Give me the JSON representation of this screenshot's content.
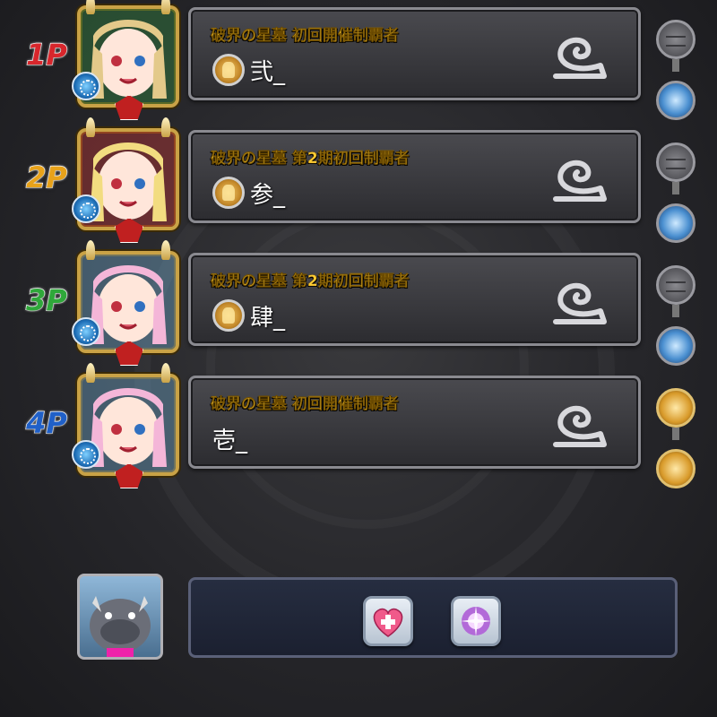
{
  "players": [
    {
      "label": "1P",
      "label_color": "#d8262c",
      "title": "破界の星墓 初回開催制覇者",
      "name": "弐_",
      "has_medal": true,
      "avatar_icon": "character-portrait-icon",
      "side_icons": [
        "grey-gauge-icon",
        "blue-gem-icon"
      ]
    },
    {
      "label": "2P",
      "label_color": "#e8a21a",
      "title": "破界の星墓 第2期初回制覇者",
      "name": "参_",
      "has_medal": true,
      "avatar_icon": "character-portrait-icon",
      "side_icons": [
        "grey-gauge-icon",
        "blue-wing-icon"
      ]
    },
    {
      "label": "3P",
      "label_color": "#2fa83a",
      "title": "破界の星墓 第2期初回制覇者",
      "name": "肆_",
      "has_medal": true,
      "avatar_icon": "character-portrait-icon",
      "side_icons": [
        "grey-gauge-icon",
        "blue-drop-icon"
      ]
    },
    {
      "label": "4P",
      "label_color": "#2060c8",
      "title": "破界の星墓 初回開催制覇者",
      "name": "壱_",
      "has_medal": false,
      "avatar_icon": "character-portrait-icon",
      "side_icons": [
        "gold-crown-icon",
        "gold-crown-icon"
      ]
    }
  ],
  "helper": {
    "avatar_icon": "helper-monster-icon",
    "items": [
      "heart-plus-icon",
      "sparkle-orb-icon"
    ]
  },
  "colors": {
    "title_gold": "#ffcc33",
    "plate_border": "#8a8a90",
    "avatar_frame": "#c9a246"
  }
}
